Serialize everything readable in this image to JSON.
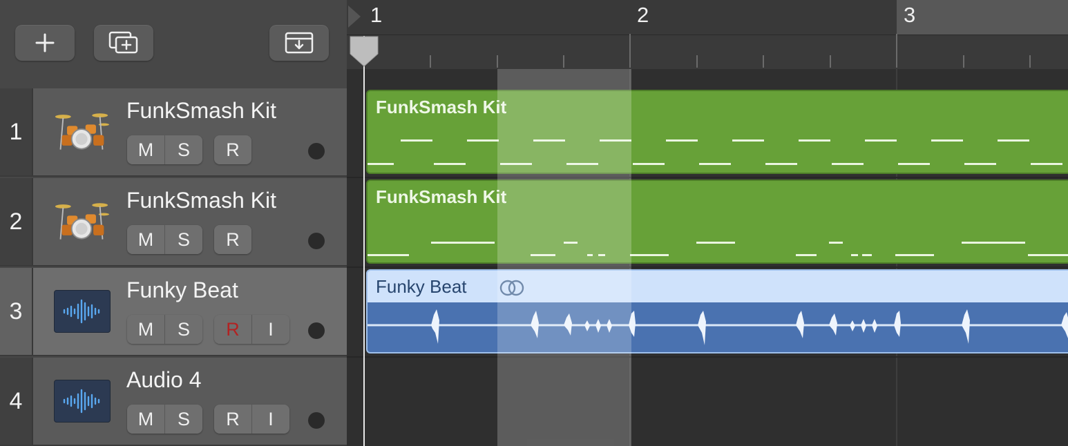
{
  "toolbar": {
    "add_track_icon": "plus-icon",
    "duplicate_track_icon": "duplicate-track-icon",
    "download_icon": "tray-download-icon"
  },
  "ruler": {
    "bars": [
      "1",
      "2",
      "3"
    ]
  },
  "tracks": [
    {
      "number": "1",
      "name": "FunkSmash Kit",
      "icon": "drum-kit-icon",
      "buttons": [
        "M",
        "S",
        "R"
      ]
    },
    {
      "number": "2",
      "name": "FunkSmash Kit",
      "icon": "drum-kit-icon",
      "buttons": [
        "M",
        "S",
        "R"
      ]
    },
    {
      "number": "3",
      "name": "Funky Beat",
      "icon": "audio-waveform-icon",
      "buttons": [
        "M",
        "S",
        "R",
        "I"
      ],
      "selected": true,
      "record_armed": true
    },
    {
      "number": "4",
      "name": "Audio 4",
      "icon": "audio-waveform-icon",
      "buttons": [
        "M",
        "S",
        "R",
        "I"
      ]
    }
  ],
  "regions": [
    {
      "name": "FunkSmash Kit",
      "type": "drummer",
      "color": "#67a138"
    },
    {
      "name": "FunkSmash Kit",
      "type": "drummer",
      "color": "#67a138"
    },
    {
      "name": "Funky Beat",
      "type": "audio",
      "color": "#4a72b0",
      "loop_icon": "loop-icon"
    }
  ]
}
